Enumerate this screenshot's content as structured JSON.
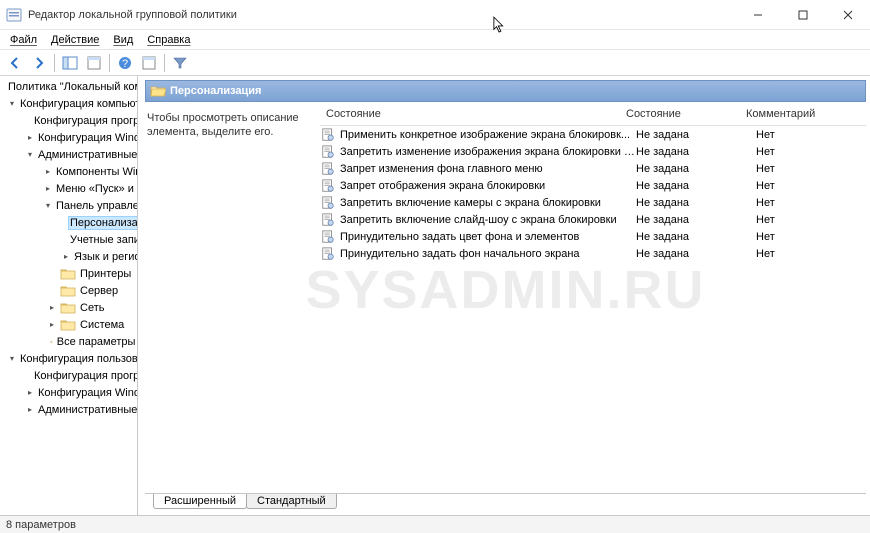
{
  "window": {
    "title": "Редактор локальной групповой политики"
  },
  "menu": {
    "file": "Файл",
    "action": "Действие",
    "view": "Вид",
    "help": "Справка"
  },
  "tree": {
    "root": "Политика \"Локальный компьютер\"",
    "computer_config": "Конфигурация компьютера",
    "cc_software": "Конфигурация программ",
    "cc_windows": "Конфигурация Windows",
    "cc_admin": "Административные шаблоны",
    "cc_components": "Компоненты Windows",
    "cc_start": "Меню «Пуск» и панель задач",
    "cc_cp": "Панель управления",
    "cc_personalization": "Персонализация",
    "cc_accounts": "Учетные записи пользователей",
    "cc_lang": "Язык и региональные стандарть",
    "cc_printers": "Принтеры",
    "cc_server": "Сервер",
    "cc_network": "Сеть",
    "cc_system": "Система",
    "cc_all": "Все параметры",
    "user_config": "Конфигурация пользователя",
    "uc_software": "Конфигурация программ",
    "uc_windows": "Конфигурация Windows",
    "uc_admin": "Административные шаблоны"
  },
  "section": "Персонализация",
  "hint": "Чтобы просмотреть описание элемента, выделите его.",
  "columns": {
    "state_header": "Состояние",
    "state": "Состояние",
    "comment": "Комментарий"
  },
  "policies": [
    {
      "name": "Применить конкретное изображение экрана блокировк...",
      "state": "Не задана",
      "comment": "Нет"
    },
    {
      "name": "Запретить изменение изображения экрана блокировки и...",
      "state": "Не задана",
      "comment": "Нет"
    },
    {
      "name": "Запрет изменения фона главного меню",
      "state": "Не задана",
      "comment": "Нет"
    },
    {
      "name": "Запрет отображения экрана блокировки",
      "state": "Не задана",
      "comment": "Нет"
    },
    {
      "name": "Запретить включение камеры с экрана блокировки",
      "state": "Не задана",
      "comment": "Нет"
    },
    {
      "name": "Запретить включение слайд-шоу с экрана блокировки",
      "state": "Не задана",
      "comment": "Нет"
    },
    {
      "name": "Принудительно задать цвет фона и элементов",
      "state": "Не задана",
      "comment": "Нет"
    },
    {
      "name": "Принудительно задать фон начального экрана",
      "state": "Не задана",
      "comment": "Нет"
    }
  ],
  "tabs": {
    "extended": "Расширенный",
    "standard": "Стандартный"
  },
  "status": "8 параметров",
  "watermark": "SYSADMIN.RU"
}
